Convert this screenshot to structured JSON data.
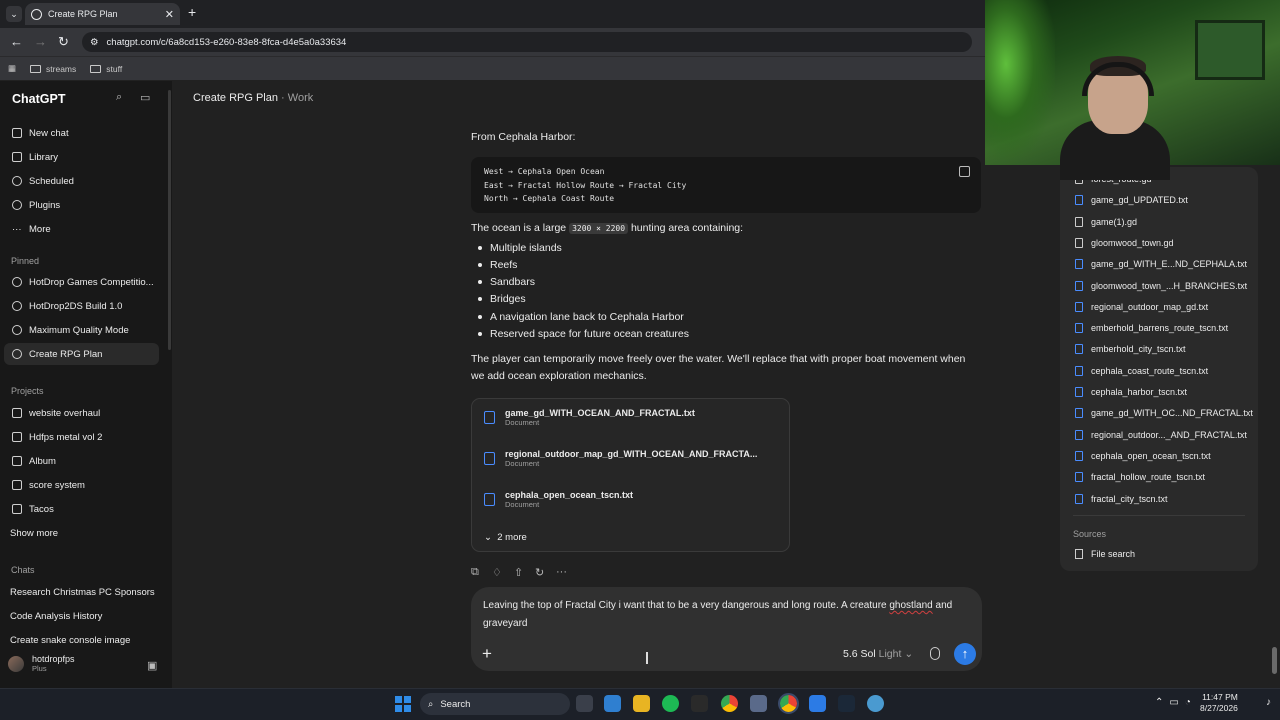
{
  "browser": {
    "tab_title": "Create RPG Plan",
    "url": "chatgpt.com/c/6a8cd153-e260-83e8-8fca-d4e5a0a33634",
    "bookmarks": [
      "streams",
      "stuff"
    ]
  },
  "sidebar": {
    "brand": "ChatGPT",
    "nav": [
      "New chat",
      "Library",
      "Scheduled",
      "Plugins",
      "More"
    ],
    "pinned_label": "Pinned",
    "pinned": [
      "HotDrop Games Competitio...",
      "HotDrop2DS Build 1.0",
      "Maximum Quality Mode",
      "Create RPG Plan"
    ],
    "projects_label": "Projects",
    "projects": [
      "website overhaul",
      "Hdfps metal vol 2",
      "Album",
      "score system",
      "Tacos"
    ],
    "show_more": "Show more",
    "chats_label": "Chats",
    "chats": [
      "Research Christmas PC Sponsors",
      "Code Analysis History",
      "Create snake console image"
    ],
    "user": {
      "name": "hotdropfps",
      "plan": "Plus"
    }
  },
  "header": {
    "title": "Create RPG Plan",
    "separator": "·",
    "project": "Work"
  },
  "message": {
    "intro": "From Cephala Harbor:",
    "code": [
      "West → Cephala Open Ocean",
      "East → Fractal Hollow Route → Fractal City",
      "North → Cephala Coast Route"
    ],
    "ocean_pre": "The ocean is a large ",
    "ocean_code": "3200 × 2200",
    "ocean_post": " hunting area containing:",
    "bullets": [
      "Multiple islands",
      "Reefs",
      "Sandbars",
      "Bridges",
      "A navigation lane back to Cephala Harbor",
      "Reserved space for future ocean creatures"
    ],
    "closing": "The player can temporarily move freely over the water. We'll replace that with proper boat movement when we add ocean exploration mechanics.",
    "files": [
      {
        "name": "game_gd_WITH_OCEAN_AND_FRACTAL.txt",
        "type": "Document"
      },
      {
        "name": "regional_outdoor_map_gd_WITH_OCEAN_AND_FRACTA...",
        "type": "Document"
      },
      {
        "name": "cephala_open_ocean_tscn.txt",
        "type": "Document"
      }
    ],
    "more_label": "2 more"
  },
  "composer": {
    "text_before": "Leaving the top of Fractal City i want that to be a very dangerous and long route. A creature ",
    "text_misspelled": "ghostland",
    "text_after": " and graveyard",
    "model": "5.6 Sol",
    "model_variant": "Light"
  },
  "files_panel": {
    "items": [
      {
        "name": "forest_route.gd",
        "kind": "code"
      },
      {
        "name": "game_gd_UPDATED.txt",
        "kind": "doc"
      },
      {
        "name": "game(1).gd",
        "kind": "code"
      },
      {
        "name": "gloomwood_town.gd",
        "kind": "code"
      },
      {
        "name": "game_gd_WITH_E...ND_CEPHALA.txt",
        "kind": "doc"
      },
      {
        "name": "gloomwood_town_...H_BRANCHES.txt",
        "kind": "doc"
      },
      {
        "name": "regional_outdoor_map_gd.txt",
        "kind": "doc"
      },
      {
        "name": "emberhold_barrens_route_tscn.txt",
        "kind": "doc"
      },
      {
        "name": "emberhold_city_tscn.txt",
        "kind": "doc"
      },
      {
        "name": "cephala_coast_route_tscn.txt",
        "kind": "doc"
      },
      {
        "name": "cephala_harbor_tscn.txt",
        "kind": "doc"
      },
      {
        "name": "game_gd_WITH_OC...ND_FRACTAL.txt",
        "kind": "doc"
      },
      {
        "name": "regional_outdoor..._AND_FRACTAL.txt",
        "kind": "doc"
      },
      {
        "name": "cephala_open_ocean_tscn.txt",
        "kind": "doc"
      },
      {
        "name": "fractal_hollow_route_tscn.txt",
        "kind": "doc"
      },
      {
        "name": "fractal_city_tscn.txt",
        "kind": "doc"
      }
    ],
    "sources_label": "Sources",
    "file_search": "File search"
  },
  "taskbar": {
    "search_label": "Search",
    "time": "11:47 PM",
    "date": "8/27/2026"
  }
}
